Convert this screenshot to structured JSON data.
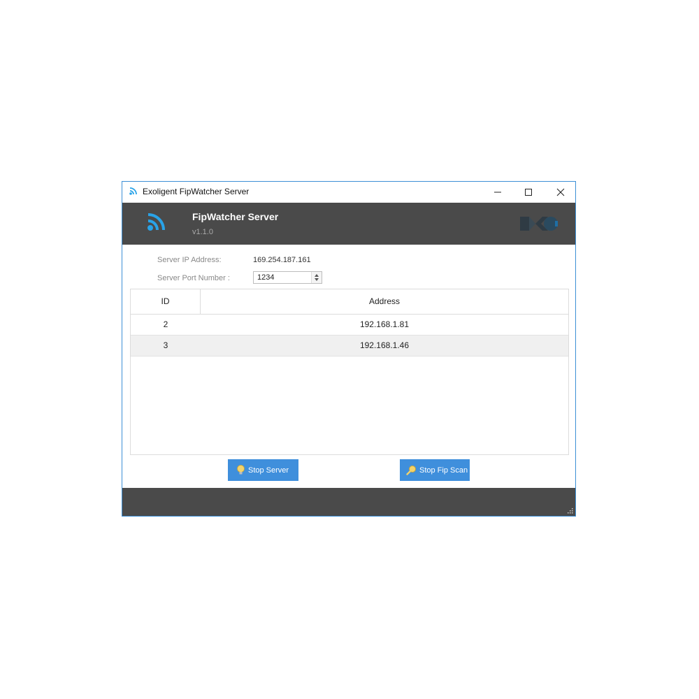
{
  "window": {
    "title": "Exoligent FipWatcher Server",
    "controls": {
      "minimize": "minimize",
      "maximize": "maximize",
      "close": "close"
    }
  },
  "header": {
    "app_title": "FipWatcher Server",
    "version": "v1.1.0",
    "icon": "wifi-signal-icon",
    "brand_logo": "exoligent-logo"
  },
  "server": {
    "ip_label": "Server IP Address:",
    "ip_value": "169.254.187.161",
    "port_label": "Server Port Number :",
    "port_value": "1234"
  },
  "table": {
    "columns": [
      "ID",
      "Address"
    ],
    "rows": [
      {
        "id": "2",
        "address": "192.168.1.81"
      },
      {
        "id": "3",
        "address": "192.168.1.46"
      }
    ]
  },
  "buttons": {
    "stop_server": "Stop Server",
    "stop_fip_scan": "Stop Fip Scan"
  },
  "colors": {
    "accent": "#3f8fdc",
    "header_bg": "#4a4a4a",
    "icon_blue": "#29a3e8",
    "window_border": "#3c8fd6"
  }
}
